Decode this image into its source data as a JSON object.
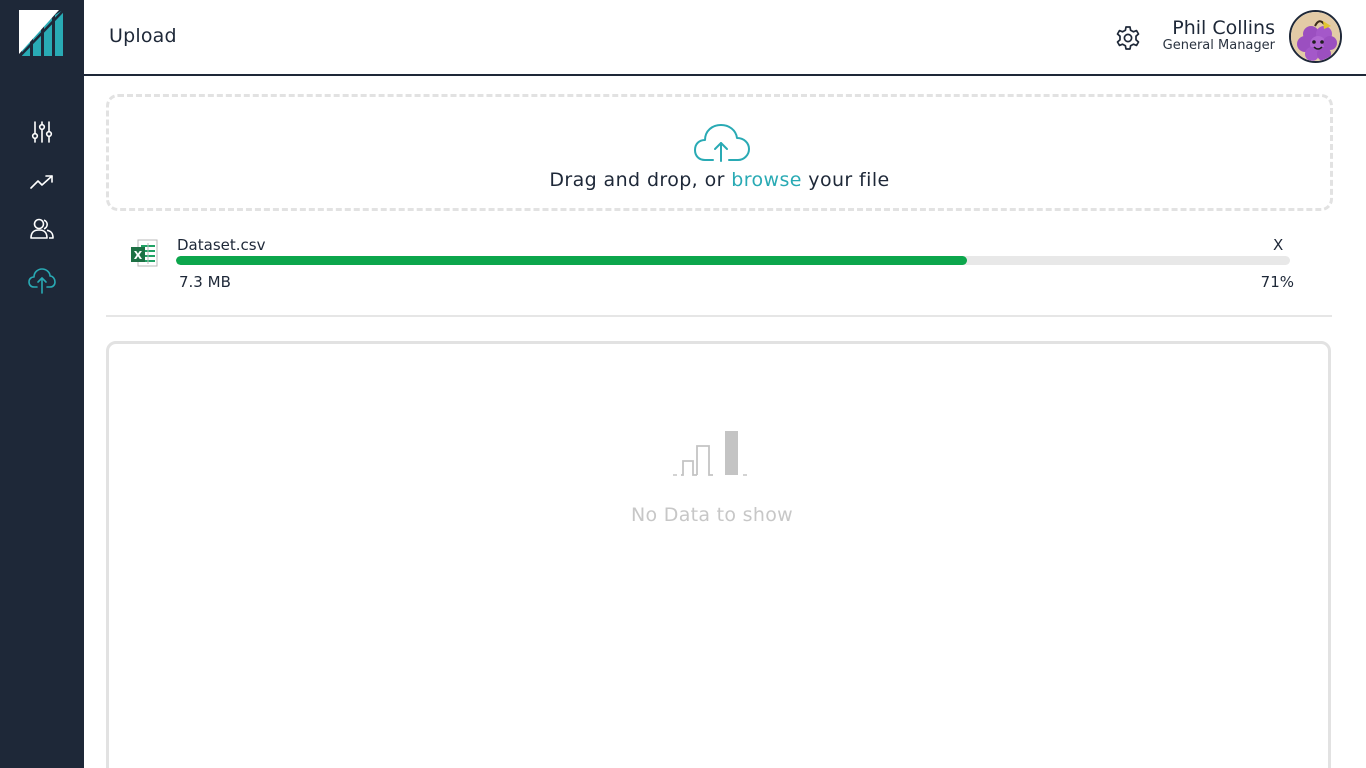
{
  "sidebar": {
    "items": [
      {
        "id": "filters",
        "icon": "sliders-icon"
      },
      {
        "id": "trends",
        "icon": "trending-up-icon"
      },
      {
        "id": "users",
        "icon": "users-icon"
      },
      {
        "id": "upload",
        "icon": "cloud-upload-icon",
        "active": true
      }
    ]
  },
  "header": {
    "title": "Upload",
    "user": {
      "name": "Phil Collins",
      "role": "General Manager"
    }
  },
  "dropzone": {
    "text_before": "Drag and drop, or ",
    "browse_label": "browse",
    "text_after": " your file"
  },
  "file": {
    "name": "Dataset.csv",
    "size": "7.3 MB",
    "progress_label": "71%",
    "progress": 0.71,
    "remove_label": "X"
  },
  "empty_state": {
    "text": "No Data to show"
  },
  "colors": {
    "sidebar_bg": "#1e2838",
    "accent": "#29aab4",
    "progress": "#0ca64c",
    "muted": "#c7c7c7"
  }
}
